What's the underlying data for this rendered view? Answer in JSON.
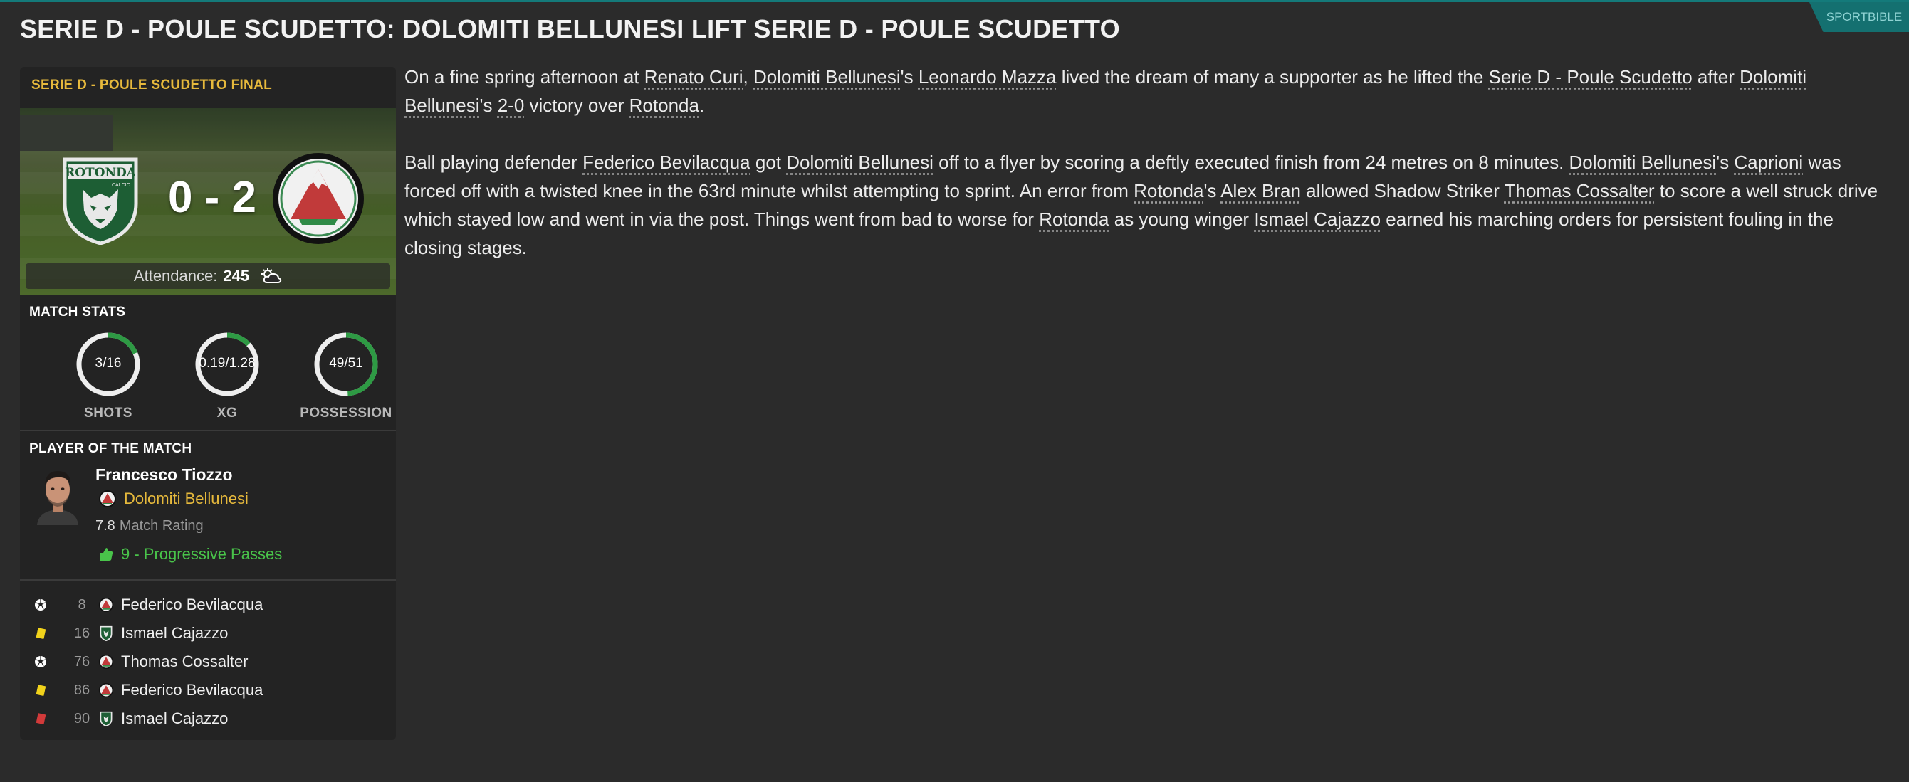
{
  "headline": "SERIE D - POULE SCUDETTO: DOLOMITI BELLUNESI LIFT SERIE D - POULE SCUDETTO",
  "source": "SPORTBIBLE",
  "match": {
    "competition_label": "SERIE D - POULE SCUDETTO FINAL",
    "home_crest_text": "ROTONDA",
    "home_crest_sub": "CALCIO",
    "score": "0 - 2",
    "attendance_label": "Attendance:",
    "attendance_value": "245",
    "weather_icon": "partly-cloudy-icon"
  },
  "stats": {
    "title": "MATCH STATS",
    "items": [
      {
        "label": "SHOTS",
        "value": "3/16",
        "fraction": 0.1875
      },
      {
        "label": "XG",
        "value": "0.19/1.28",
        "fraction": 0.13
      },
      {
        "label": "POSSESSION",
        "value": "49/51",
        "fraction": 0.49
      }
    ]
  },
  "potm": {
    "title": "PLAYER OF THE MATCH",
    "name": "Francesco Tiozzo",
    "club": "Dolomiti Bellunesi",
    "rating": "7.8",
    "rating_label": "Match Rating",
    "stat": "9 - Progressive Passes"
  },
  "events": [
    {
      "type": "goal",
      "icon": "football-icon",
      "minute": "8",
      "team": "away",
      "player": "Federico Bevilacqua"
    },
    {
      "type": "yellow",
      "icon": "yellow-card-icon",
      "minute": "16",
      "team": "home",
      "player": "Ismael Cajazzo"
    },
    {
      "type": "goal",
      "icon": "football-icon",
      "minute": "76",
      "team": "away",
      "player": "Thomas Cossalter"
    },
    {
      "type": "yellow",
      "icon": "yellow-card-icon",
      "minute": "86",
      "team": "away",
      "player": "Federico Bevilacqua"
    },
    {
      "type": "red",
      "icon": "red-card-icon",
      "minute": "90",
      "team": "home",
      "player": "Ismael Cajazzo"
    }
  ],
  "article": {
    "p1": {
      "t1": "On a fine spring afternoon at ",
      "l_stadium": "Renato Curi",
      "t2": ", ",
      "l_club1": "Dolomiti Bellunesi",
      "t3": "'s ",
      "l_player1": "Leonardo Mazza",
      "t4": " lived the dream of many a supporter as he lifted the ",
      "l_comp": "Serie D - Poule Scudetto",
      "t5": " after ",
      "l_club2": "Dolomiti Bellunesi",
      "t6": "'s ",
      "l_score": "2-0",
      "t7": " victory over ",
      "l_club3": "Rotonda",
      "t8": "."
    },
    "p2": {
      "t1": "Ball playing defender ",
      "l_p1": "Federico Bevilacqua",
      "t2": " got ",
      "l_c1": "Dolomiti Bellunesi",
      "t3": " off to a flyer by scoring a deftly executed finish from 24 metres on 8 minutes. ",
      "l_c2": "Dolomiti Bellunesi",
      "t4": "'s ",
      "l_p2": "Caprioni",
      "t5": " was forced off with a twisted knee in the 63rd minute whilst attempting to sprint. An error from ",
      "l_c3": "Rotonda",
      "t6": "'s ",
      "l_p3": "Alex Bran",
      "t7": " allowed Shadow Striker ",
      "l_p4": "Thomas Cossalter",
      "t8": " to score a well struck drive which stayed low and went in via the post. Things went from bad to worse for ",
      "l_c4": "Rotonda",
      "t9": " as young winger ",
      "l_p5": "Ismael Cajazzo",
      "t10": " earned his marching orders for persistent fouling in the closing stages."
    }
  },
  "colors": {
    "accent": "#e6b93c",
    "positive": "#49c44a",
    "teal": "#147a7a",
    "gauge_fill": "#2e9a44"
  }
}
